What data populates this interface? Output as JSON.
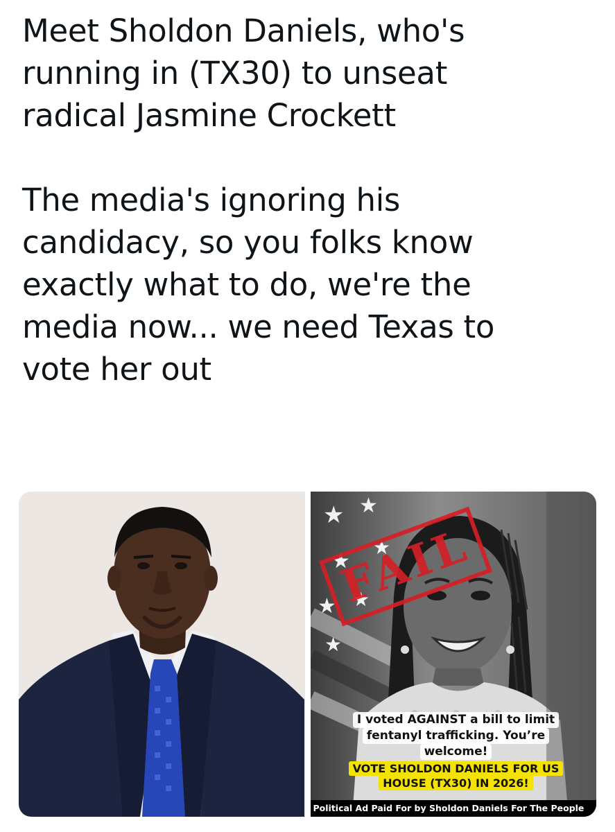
{
  "tweet": {
    "paragraph_1": "Meet Sholdon Daniels, who's\nrunning in (TX30) to unseat\nradical Jasmine Crockett",
    "paragraph_2": "The media's ignoring his\ncandidacy, so you folks know\nexactly what to do, we're the\nmedia now... we need Texas to\nvote her out"
  },
  "media": {
    "left_image": {
      "subject": "Portrait of Sholdon Daniels in suit and blue tie"
    },
    "right_image": {
      "stamp": "FAIL",
      "quote_lines": [
        "I voted AGAINST a bill to limit",
        "fentanyl trafficking. You’re",
        "welcome!"
      ],
      "cta_lines": [
        "VOTE SHOLDON DANIELS FOR US",
        "HOUSE (TX30) IN 2026!"
      ],
      "disclaimer": "Political Ad Paid For by Sholdon Daniels For The People"
    }
  },
  "colors": {
    "text": "#0f1419",
    "stamp_red": "#d41f26",
    "cta_yellow": "#f4e300",
    "suit_navy": "#1c2440",
    "tie_blue": "#2747b8"
  }
}
